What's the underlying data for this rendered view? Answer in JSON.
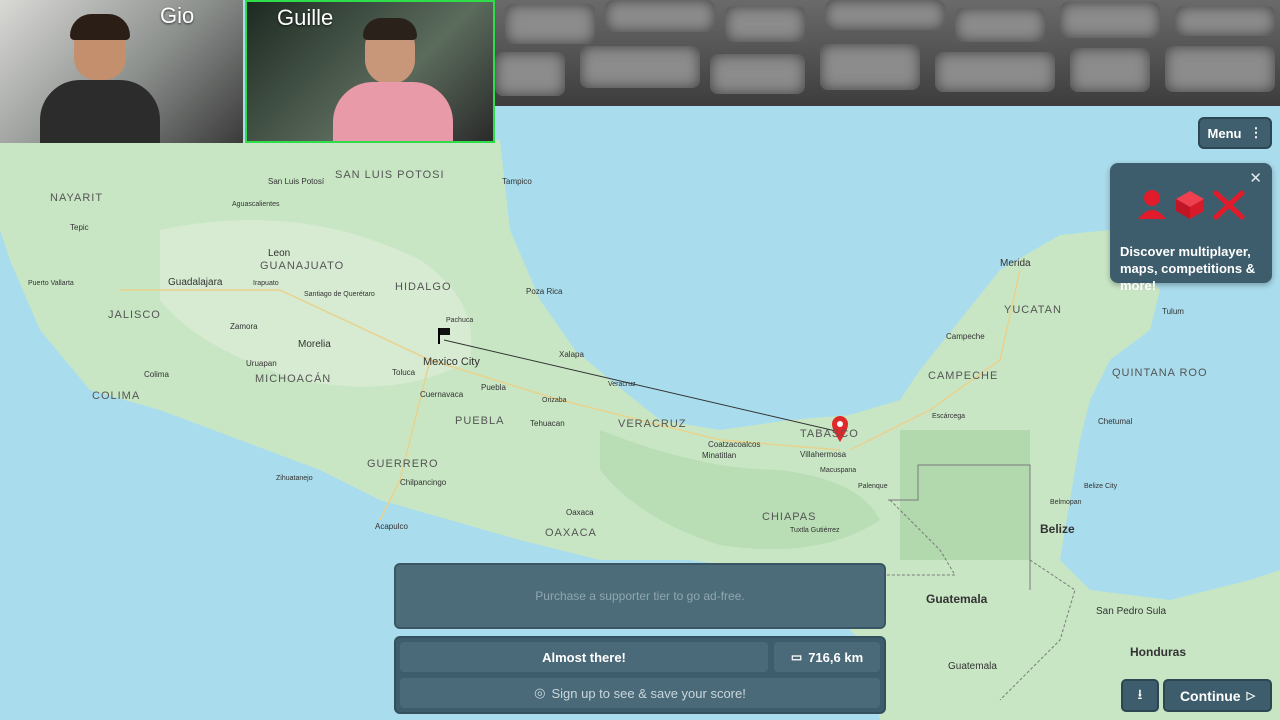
{
  "participants": [
    {
      "name": "Gio"
    },
    {
      "name": "Guille"
    }
  ],
  "map": {
    "labels_large": [
      "NAYARIT",
      "JALISCO",
      "COLIMA",
      "MICHOACÁN",
      "GUERRERO",
      "OAXACA",
      "PUEBLA",
      "HIDALGO",
      "GUANAJUATO",
      "SAN LUIS POTOSI",
      "VERACRUZ",
      "TABASCO",
      "CHIAPAS",
      "CAMPECHE",
      "YUCATAN",
      "QUINTANA ROO"
    ],
    "labels_country": [
      "Belize",
      "Guatemala",
      "Honduras"
    ],
    "labels_city": [
      "Mexico City",
      "Guadalajara",
      "Leon",
      "Merida",
      "Morelia",
      "Toluca",
      "Puebla",
      "Acapulco",
      "Villahermosa",
      "Coatzacoalcos",
      "Oaxaca",
      "Tepic",
      "Colima",
      "Zamora",
      "Uruapan",
      "Xalapa",
      "Pachuca",
      "Cuernavaca",
      "Chilpancingo",
      "Tuxtla Gutiérrez",
      "Campeche",
      "Chetumal",
      "Tulum",
      "San Pedro Sula",
      "Guatemala",
      "Tampico",
      "Poza Rica",
      "Veracruz",
      "Orizaba",
      "Tehuacan",
      "Minatitlan",
      "Macuspana",
      "Palenque",
      "Escárcega",
      "Belmopan",
      "Belize City",
      "Irapuato",
      "San Luis Potosí",
      "Aguascalientes",
      "Puerto Vallarta",
      "Zihuatanejo",
      "Santiago de Querétaro"
    ],
    "guess_marker": "flag-marker",
    "answer_marker": "red-pin-marker"
  },
  "menu": {
    "label": "Menu"
  },
  "promo": {
    "text": "Discover multiplayer, maps, competitions & more!"
  },
  "ad": {
    "text": "Purchase a supporter tier to go ad-free."
  },
  "result": {
    "status": "Almost there!",
    "distance": "716,6 km",
    "signup": "Sign up to see & save your score!"
  },
  "continue": {
    "label": "Continue"
  }
}
